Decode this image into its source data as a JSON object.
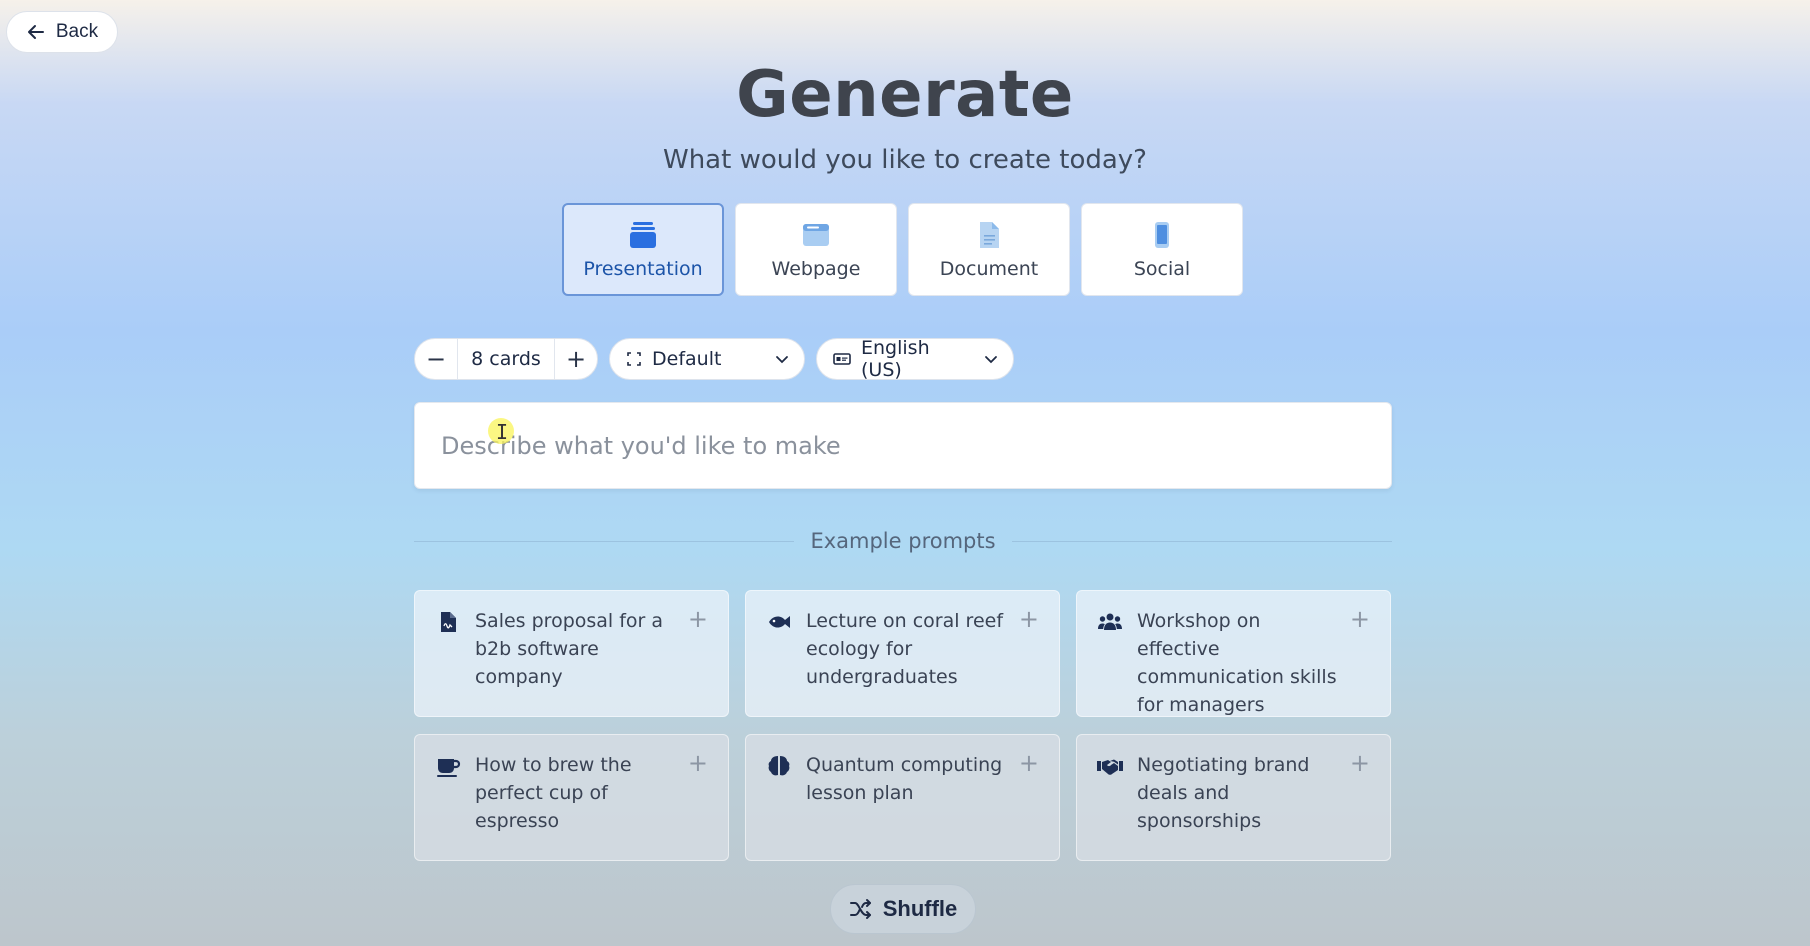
{
  "back": {
    "label": "Back"
  },
  "header": {
    "title": "Generate",
    "subtitle": "What would you like to create today?"
  },
  "types": [
    {
      "label": "Presentation",
      "icon": "presentation-icon",
      "active": true
    },
    {
      "label": "Webpage",
      "icon": "webpage-icon",
      "active": false
    },
    {
      "label": "Document",
      "icon": "document-icon",
      "active": false
    },
    {
      "label": "Social",
      "icon": "phone-icon",
      "active": false
    }
  ],
  "controls": {
    "cards_label": "8 cards",
    "decrement": "−",
    "increment": "+",
    "format_label": "Default",
    "language_label": "English (US)"
  },
  "prompt": {
    "placeholder": "Describe what you'd like to make",
    "value": ""
  },
  "examples": {
    "heading": "Example prompts",
    "items": [
      {
        "text": "Sales proposal for a b2b software company",
        "icon": "file-signature-icon"
      },
      {
        "text": "Lecture on coral reef ecology for undergraduates",
        "icon": "fish-icon"
      },
      {
        "text": "Workshop on effective communication skills for managers",
        "icon": "users-icon"
      },
      {
        "text": "How to brew the perfect cup of espresso",
        "icon": "coffee-cup-icon"
      },
      {
        "text": "Quantum computing lesson plan",
        "icon": "brain-icon"
      },
      {
        "text": "Negotiating brand deals and sponsorships",
        "icon": "handshake-icon"
      }
    ],
    "add_symbol": "+"
  },
  "shuffle": {
    "label": "Shuffle"
  },
  "colors": {
    "accent": "#1c54a8",
    "icon_blue": "#2a6fe0",
    "icon_navy": "#1e2f55"
  }
}
